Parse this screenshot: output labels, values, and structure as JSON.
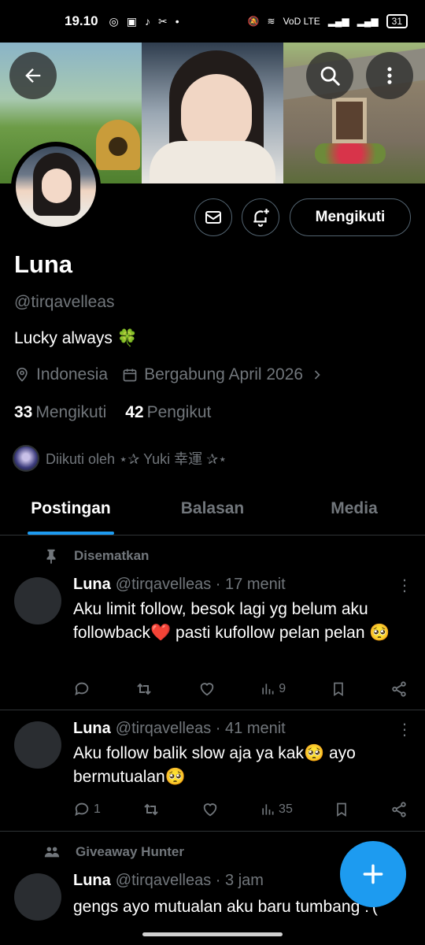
{
  "status_bar": {
    "time": "19.10",
    "carrier": "VoD LTE",
    "battery": "31"
  },
  "header": {
    "back_icon": "arrow-left-icon",
    "search_icon": "search-icon",
    "more_icon": "more-vertical-icon"
  },
  "profile": {
    "name": "Luna",
    "handle": "@tirqavelleas",
    "bio": "Lucky always 🍀",
    "location": "Indonesia",
    "joined": "Bergabung April 2026",
    "following_count": "33",
    "following_label": "Mengikuti",
    "followers_count": "42",
    "followers_label": "Pengikut",
    "followed_by": "Diikuti oleh ⋆✰ Yuki 幸運 ✰⋆",
    "follow_button": "Mengikuti"
  },
  "tabs": [
    {
      "label": "Postingan",
      "active": true
    },
    {
      "label": "Balasan",
      "active": false
    },
    {
      "label": "Media",
      "active": false
    }
  ],
  "posts": [
    {
      "context": "Disematkan",
      "context_icon": "pin-icon",
      "name": "Luna",
      "meta": "@tirqavelleas · 17 menit",
      "text": "Aku limit follow, besok lagi yg belum aku followback❤️ pasti kufollow pelan pelan 🥺",
      "replies": "",
      "views": "9"
    },
    {
      "context": "",
      "name": "Luna",
      "meta": "@tirqavelleas · 41 menit",
      "text": "Aku follow balik slow aja ya kak🥺 ayo bermutualan🥺",
      "replies": "1",
      "views": "35"
    },
    {
      "context": "Giveaway Hunter",
      "context_icon": "community-icon",
      "name": "Luna",
      "meta": "@tirqavelleas · 3 jam",
      "text": "gengs ayo mutualan aku baru tumbang :'("
    }
  ],
  "colors": {
    "accent": "#1d9bf0",
    "background": "#000000",
    "muted": "#71767b",
    "border": "#2f3336"
  }
}
